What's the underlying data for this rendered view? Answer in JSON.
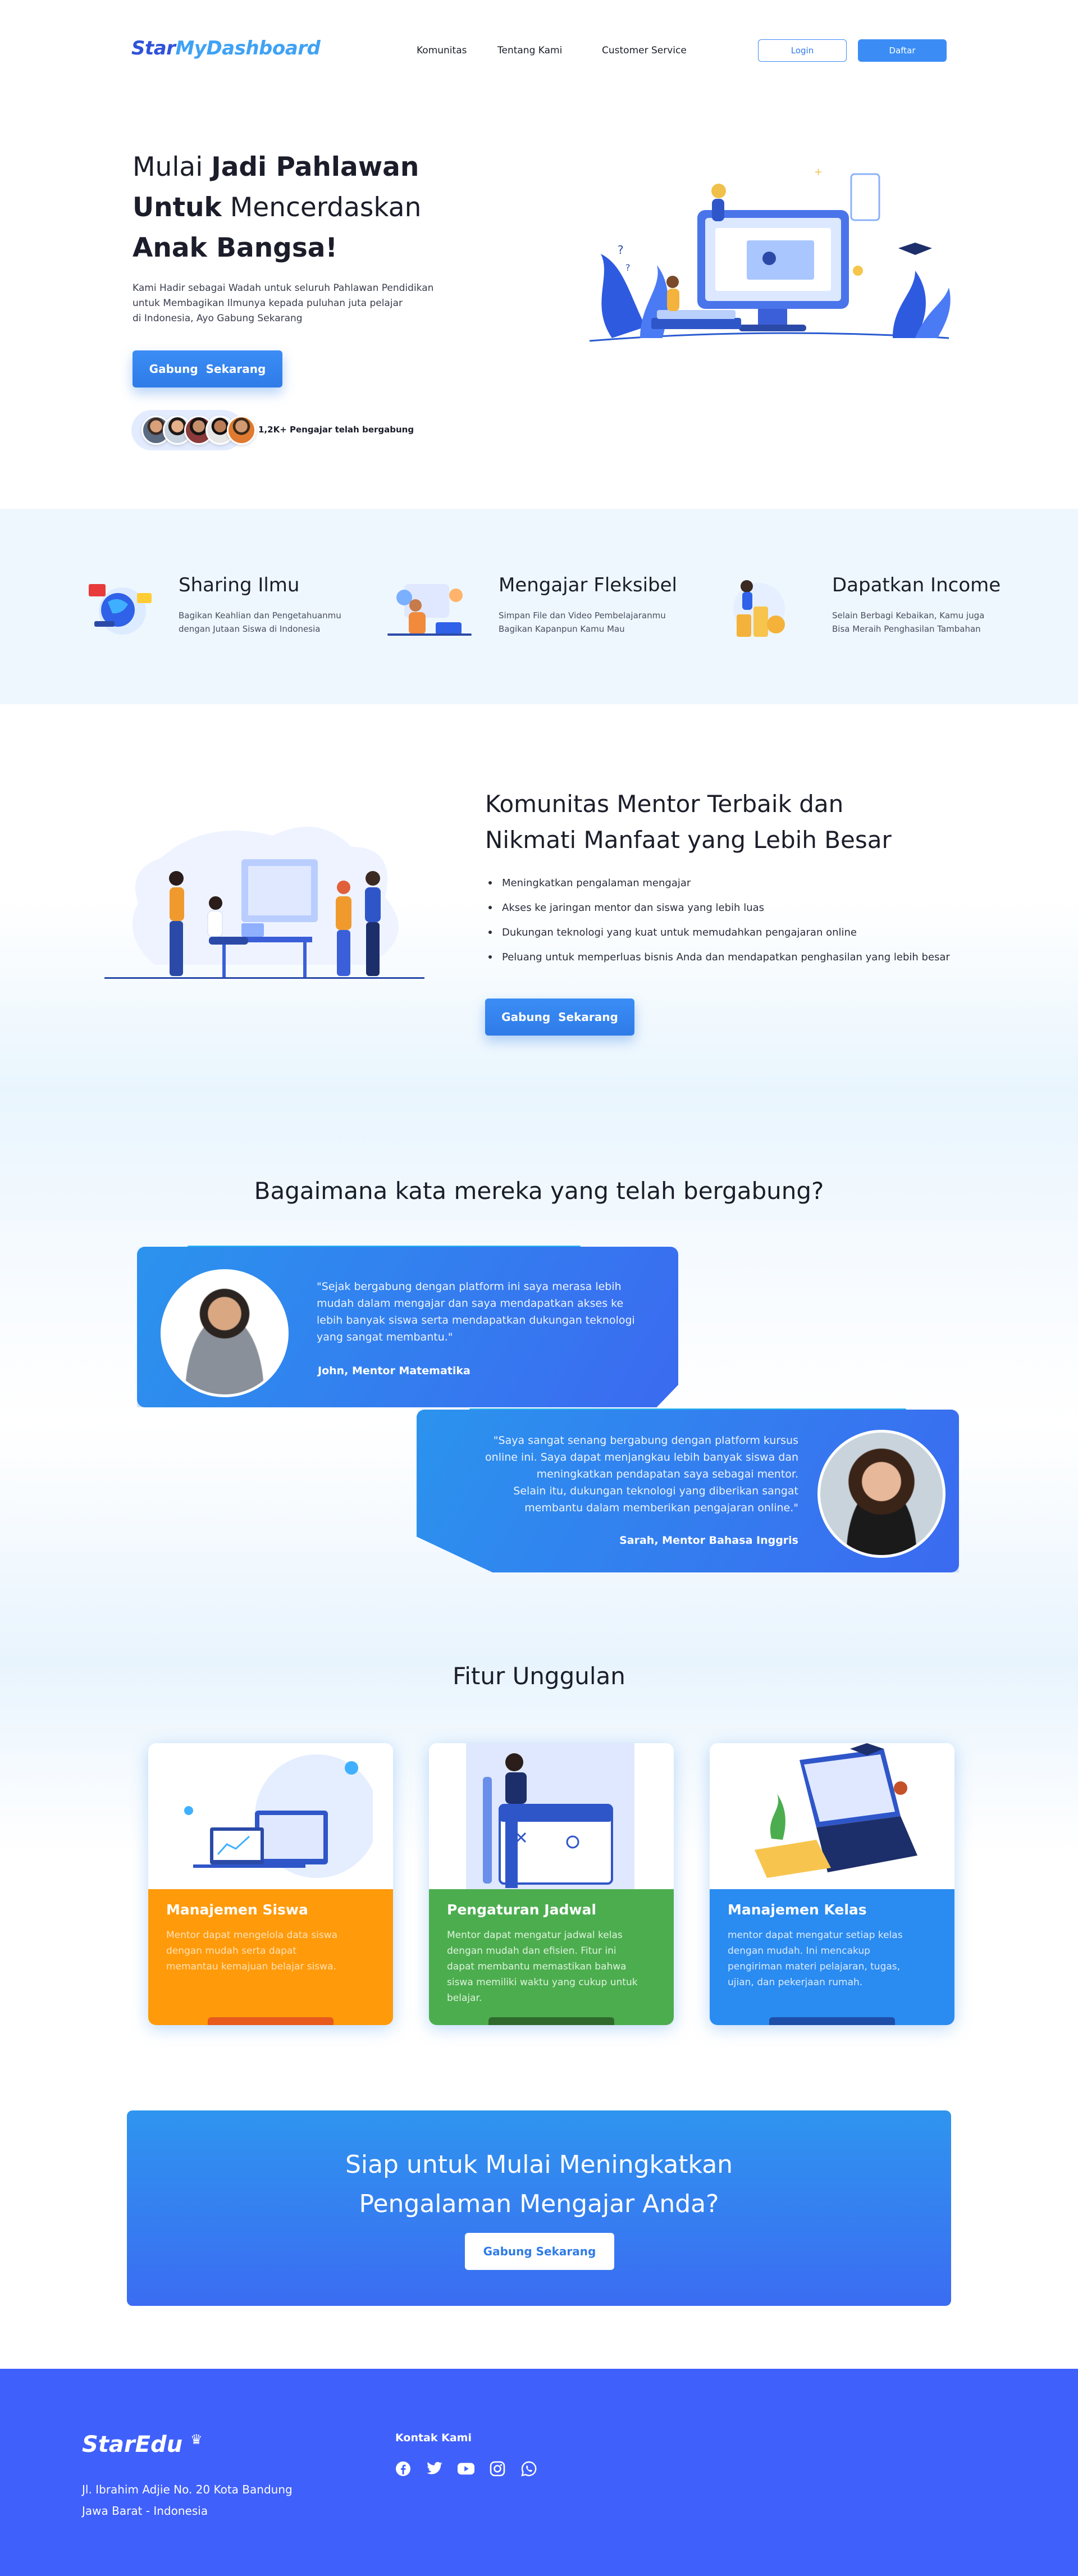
{
  "brand": {
    "logo_part1": "Star",
    "logo_part2": "MyDashboard"
  },
  "nav": {
    "links": [
      "Komunitas",
      "Tentang Kami",
      "Customer Service"
    ],
    "login": "Login",
    "signup": "Daftar"
  },
  "hero": {
    "title_l1_a": "Mulai ",
    "title_l1_b": "Jadi Pahlawan",
    "title_l2_a": "Untuk",
    "title_l2_b": " Mencerdaskan",
    "title_l3": "Anak Bangsa!",
    "desc_l1": "Kami Hadir sebagai Wadah untuk seluruh Pahlawan Pendidikan",
    "desc_l2": "untuk Membagikan Ilmunya kepada puluhan juta pelajar",
    "desc_l3": "di Indonesia, Ayo Gabung Sekarang",
    "cta": "Gabung  Sekarang",
    "joined": "1,2K+ Pengajar telah bergabung"
  },
  "features_strip": [
    {
      "title": "Sharing Ilmu",
      "desc_l1": "Bagikan Keahlian dan Pengetahuanmu",
      "desc_l2": "dengan Jutaan Siswa di Indonesia"
    },
    {
      "title": "Mengajar Fleksibel",
      "desc_l1": "Simpan File dan Video Pembelajaranmu",
      "desc_l2": "Bagikan Kapanpun Kamu Mau"
    },
    {
      "title": "Dapatkan Income",
      "desc_l1": "Selain Berbagi Kebaikan, Kamu juga",
      "desc_l2": "Bisa Meraih Penghasilan Tambahan"
    }
  ],
  "community": {
    "title_l1": "Komunitas Mentor Terbaik dan",
    "title_l2": "Nikmati Manfaat yang Lebih Besar",
    "bullets": [
      "Meningkatkan pengalaman mengajar",
      "Akses ke jaringan mentor dan siswa yang lebih luas",
      "Dukungan teknologi yang kuat untuk memudahkan pengajaran online",
      "Peluang untuk memperluas bisnis Anda dan mendapatkan penghasilan yang lebih besar"
    ],
    "cta": "Gabung  Sekarang"
  },
  "testimonials": {
    "heading": "Bagaimana kata mereka yang telah bergabung?",
    "items": [
      {
        "q1": "\"Sejak bergabung dengan platform ini saya merasa lebih",
        "q2": "mudah dalam mengajar dan saya mendapatkan akses ke",
        "q3": "lebih banyak siswa serta mendapatkan dukungan teknologi",
        "q4": "yang sangat membantu.\"",
        "name": "John, Mentor Matematika"
      },
      {
        "q1": "\"Saya sangat senang bergabung dengan platform kursus",
        "q2": "online ini. Saya dapat menjangkau lebih banyak siswa dan",
        "q3": "meningkatkan pendapatan saya sebagai mentor.",
        "q4": "Selain itu, dukungan teknologi yang diberikan sangat",
        "q5": "membantu dalam memberikan pengajaran online.\"",
        "name": "Sarah, Mentor Bahasa Inggris"
      }
    ]
  },
  "fitur": {
    "heading": "Fitur Unggulan",
    "cards": [
      {
        "title": "Manajemen Siswa",
        "d1": "Mentor dapat mengelola data siswa",
        "d2": "dengan mudah serta dapat",
        "d3": "memantau kemajuan belajar siswa.",
        "d4": "",
        "d5": "",
        "color": "#ff9a0a",
        "bar": "#e85a1c"
      },
      {
        "title": "Pengaturan Jadwal",
        "d1": "Mentor dapat mengatur jadwal kelas",
        "d2": "dengan mudah dan efisien. Fitur ini",
        "d3": "dapat membantu memastikan bahwa",
        "d4": "siswa memiliki waktu yang cukup untuk",
        "d5": "belajar.",
        "color": "#4cad4f",
        "bar": "#2f6a2c"
      },
      {
        "title": "Manajemen Kelas",
        "d1": "mentor dapat mengatur setiap kelas",
        "d2": "dengan mudah. Ini mencakup",
        "d3": "pengiriman materi pelajaran, tugas,",
        "d4": "ujian, dan pekerjaan rumah.",
        "d5": "",
        "color": "#2a8bf0",
        "bar": "#1d4fa8"
      }
    ]
  },
  "cta_banner": {
    "title_l1": "Siap untuk Mulai Meningkatkan",
    "title_l2": "Pengalaman Mengajar Anda?",
    "button": "Gabung Sekarang"
  },
  "footer": {
    "logo": "StarEdu",
    "address_l1": "Jl. Ibrahim Adjie No. 20 Kota Bandung",
    "address_l2": "Jawa Barat - Indonesia",
    "contact_title": "Kontak Kami",
    "socials": [
      "facebook-icon",
      "twitter-icon",
      "youtube-icon",
      "instagram-icon",
      "whatsapp-icon"
    ]
  }
}
